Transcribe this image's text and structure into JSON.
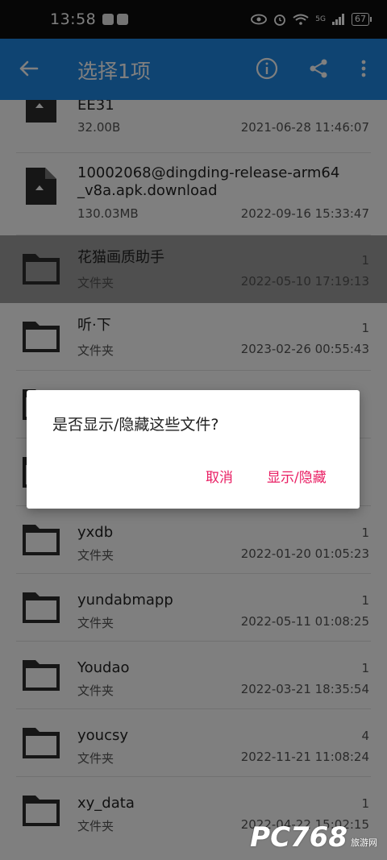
{
  "status_bar": {
    "time": "13:58",
    "battery": "67",
    "network": "5G"
  },
  "app_bar": {
    "title": "选择1项"
  },
  "files": [
    {
      "name": "EE31",
      "meta": "32.00B",
      "count": "",
      "date": "2021-06-28 11:46:07",
      "kind": "file"
    },
    {
      "name": "10002068@dingding-release-arm64_v8a.apk.download",
      "meta": "130.03MB",
      "count": "",
      "date": "2022-09-16 15:33:47",
      "kind": "file"
    },
    {
      "name": "花猫画质助手",
      "meta": "文件夹",
      "count": "1",
      "date": "2022-05-10 17:19:13",
      "kind": "folder",
      "selected": true
    },
    {
      "name": "听·下",
      "meta": "文件夹",
      "count": "1",
      "date": "2023-02-26 00:55:43",
      "kind": "folder"
    },
    {
      "name": "yxdb",
      "meta": "文件夹",
      "count": "1",
      "date": "2022-01-20 01:05:23",
      "kind": "folder"
    },
    {
      "name": "yundabmapp",
      "meta": "文件夹",
      "count": "1",
      "date": "2022-05-11 01:08:25",
      "kind": "folder"
    },
    {
      "name": "Youdao",
      "meta": "文件夹",
      "count": "1",
      "date": "2022-03-21 18:35:54",
      "kind": "folder"
    },
    {
      "name": "youcsy",
      "meta": "文件夹",
      "count": "4",
      "date": "2022-11-21 11:08:24",
      "kind": "folder"
    },
    {
      "name": "xy_data",
      "meta": "文件夹",
      "count": "1",
      "date": "2022-04-22 15:02:15",
      "kind": "folder"
    }
  ],
  "dialog": {
    "message": "是否显示/隐藏这些文件?",
    "cancel_label": "取消",
    "confirm_label": "显示/隐藏"
  },
  "watermark": {
    "text": "PC768",
    "sub": "旅游网"
  },
  "colors": {
    "app_bar": "#1e88e5",
    "accent": "#e91e63",
    "selected_row": "#9e9e9e"
  },
  "icons": [
    "back-arrow-icon",
    "info-icon",
    "share-icon",
    "more-vert-icon",
    "folder-icon",
    "file-icon"
  ]
}
